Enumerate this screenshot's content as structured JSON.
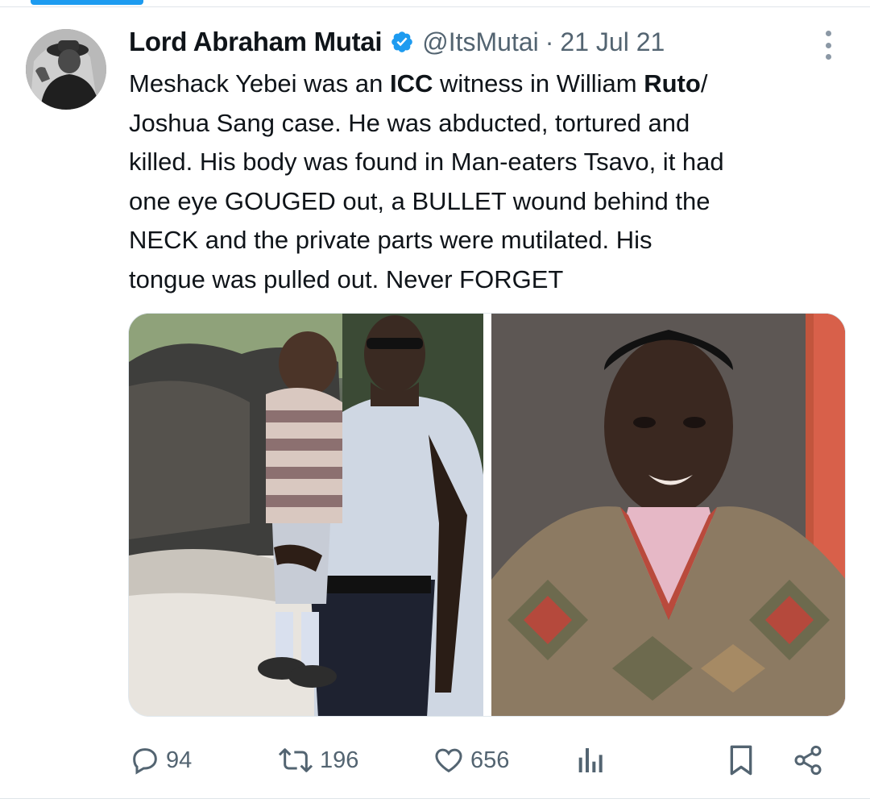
{
  "tweet": {
    "author_name": "Lord Abraham Mutai",
    "handle": "@ItsMutai",
    "separator": "·",
    "date": "21 Jul 21",
    "text_lines": [
      [
        {
          "t": "Meshack Yebei was an ",
          "b": false
        },
        {
          "t": "ICC",
          "b": true
        },
        {
          "t": " witness in William ",
          "b": false
        },
        {
          "t": "Ruto",
          "b": true
        },
        {
          "t": "/",
          "b": false
        }
      ],
      [
        {
          "t": "Joshua Sang case. He was abducted, tortured and",
          "b": false
        }
      ],
      [
        {
          "t": "killed. His body was found in Man-eaters Tsavo, it had",
          "b": false
        }
      ],
      [
        {
          "t": "one eye GOUGED out, a BULLET wound behind the",
          "b": false
        }
      ],
      [
        {
          "t": "NECK and the private parts were mutilated. His",
          "b": false
        }
      ],
      [
        {
          "t": "tongue was pulled out. Never FORGET",
          "b": false
        }
      ]
    ]
  },
  "stats": {
    "replies": "94",
    "reposts": "196",
    "likes": "656"
  },
  "icons": {
    "verified": "verified-badge-icon",
    "more": "more-options-icon",
    "reply": "reply-icon",
    "repost": "repost-icon",
    "like": "heart-icon",
    "views": "analytics-icon",
    "bookmark": "bookmark-icon",
    "share": "share-icon"
  },
  "colors": {
    "accent": "#1d9bf0",
    "text": "#0f1419",
    "secondary": "#536471"
  }
}
